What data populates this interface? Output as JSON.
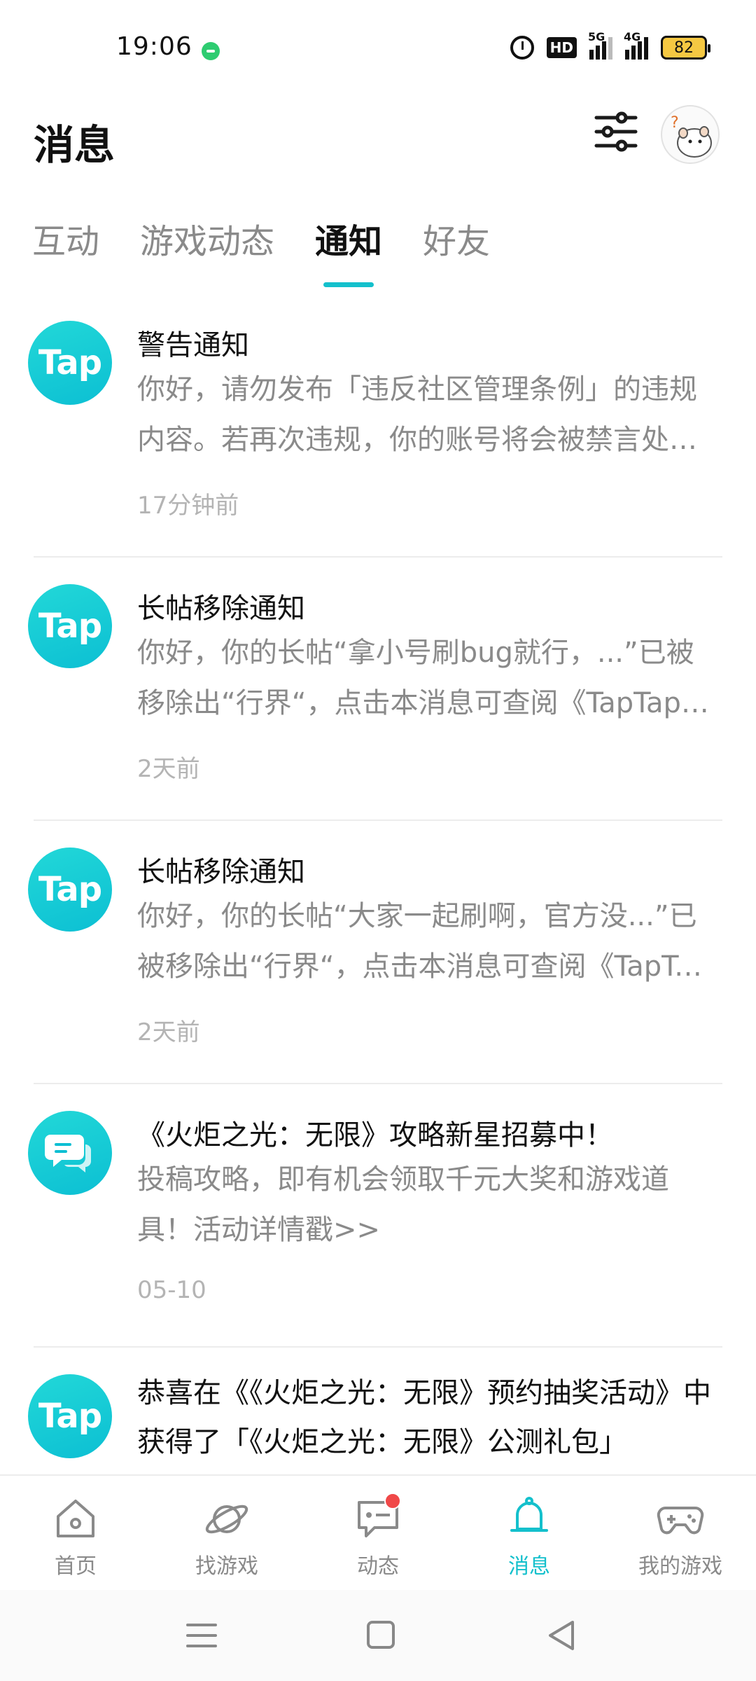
{
  "status_bar": {
    "time": "19:06",
    "hd_label": "HD",
    "net_5g": "5G",
    "net_4g": "4G",
    "battery": "82"
  },
  "header": {
    "title": "消息",
    "filter_icon": "sliders-icon",
    "avatar_icon": "hamster-avatar-icon"
  },
  "tabs": [
    {
      "label": "互动",
      "active": false
    },
    {
      "label": "游戏动态",
      "active": false
    },
    {
      "label": "通知",
      "active": true
    },
    {
      "label": "好友",
      "active": false
    }
  ],
  "notifications": [
    {
      "icon": "taptap-logo-icon",
      "logo_text": "Tap",
      "title": "警告通知",
      "body": "你好，请勿发布「违反社区管理条例」的违规内容。若再次违规，你的账号将会被禁言处理。",
      "time": "17分钟前"
    },
    {
      "icon": "taptap-logo-icon",
      "logo_text": "Tap",
      "title": "长帖移除通知",
      "body": "你好，你的长帖“拿小号刷bug就行，...”已被移除出“行界“，点击本消息可查阅《TapTap社区规范》",
      "time": "2天前"
    },
    {
      "icon": "taptap-logo-icon",
      "logo_text": "Tap",
      "title": "长帖移除通知",
      "body": "你好，你的长帖“大家一起刷啊，官方没...”已被移除出“行界“，点击本消息可查阅《TapTap社区规范》",
      "time": "2天前"
    },
    {
      "icon": "chat-bubble-icon",
      "logo_text": "",
      "title": "《火炬之光：无限》攻略新星招募中！",
      "body": "投稿攻略，即有机会领取千元大奖和游戏道具！活动详情戳>>",
      "time": "05-10"
    },
    {
      "icon": "taptap-logo-icon",
      "logo_text": "Tap",
      "title": "恭喜在《《火炬之光：无限》预约抽奖活动》中获得了「《火炬之光：无限》公测礼包」",
      "body": "",
      "time": ""
    }
  ],
  "bottom_nav": [
    {
      "label": "首页",
      "icon": "home-icon",
      "active": false
    },
    {
      "label": "找游戏",
      "icon": "planet-icon",
      "active": false
    },
    {
      "label": "动态",
      "icon": "chat-icon",
      "active": false,
      "badge": true
    },
    {
      "label": "消息",
      "icon": "bell-icon",
      "active": true
    },
    {
      "label": "我的游戏",
      "icon": "gamepad-icon",
      "active": false
    }
  ],
  "colors": {
    "accent": "#14c0cc",
    "badge": "#f04848"
  }
}
